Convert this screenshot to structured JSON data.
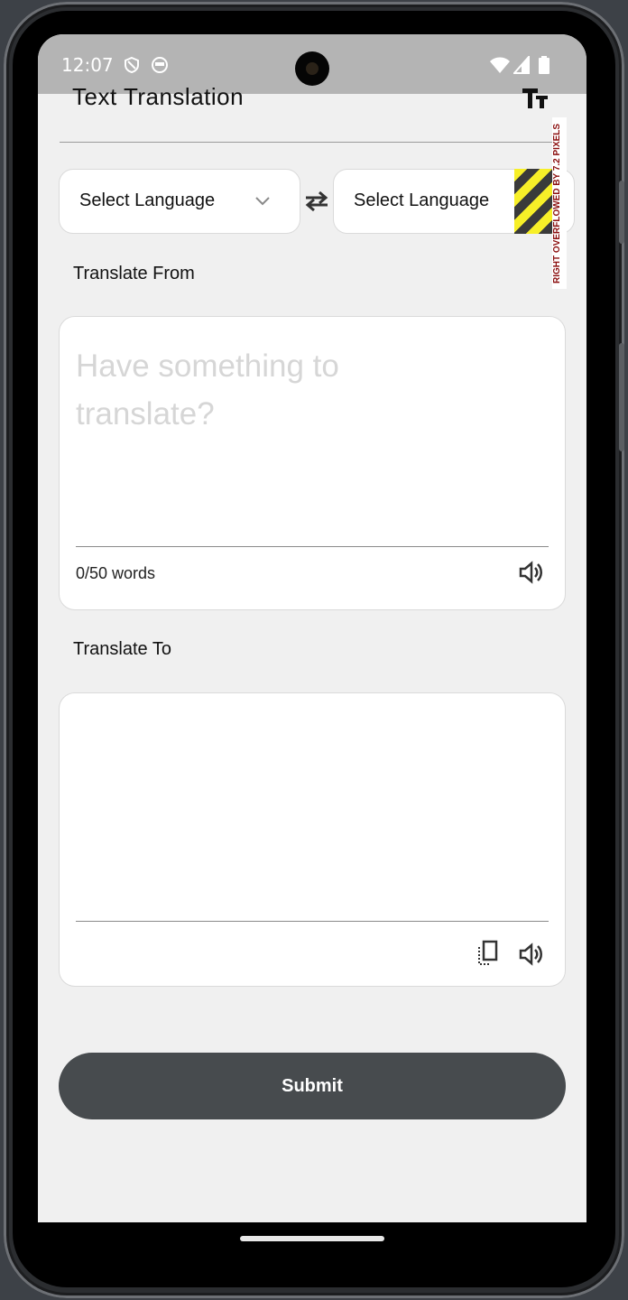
{
  "status_bar": {
    "time": "12:07",
    "icons": [
      "shield-icon",
      "face-icon",
      "wifi-icon",
      "signal-icon",
      "battery-icon"
    ]
  },
  "app_bar": {
    "title": "Text Translation",
    "text_size_icon": "text-size-icon"
  },
  "language_selector": {
    "source_label": "Select Language",
    "target_label": "Select Language",
    "swap_icon": "swap-icon",
    "overflow_warning": "RIGHT OVERFLOWED BY 7.2 PIXELS"
  },
  "translate_from": {
    "label": "Translate From",
    "placeholder": "Have something to translate?",
    "value": "",
    "word_count": "0/50 words"
  },
  "translate_to": {
    "label": "Translate To",
    "value": ""
  },
  "submit_label": "Submit",
  "colors": {
    "background": "#f0f0f0",
    "status_bar": "#b4b4b4",
    "submit_button": "#474b4e",
    "overflow_stripe_yellow": "#f7ef28",
    "overflow_text": "#8a0d0d"
  }
}
